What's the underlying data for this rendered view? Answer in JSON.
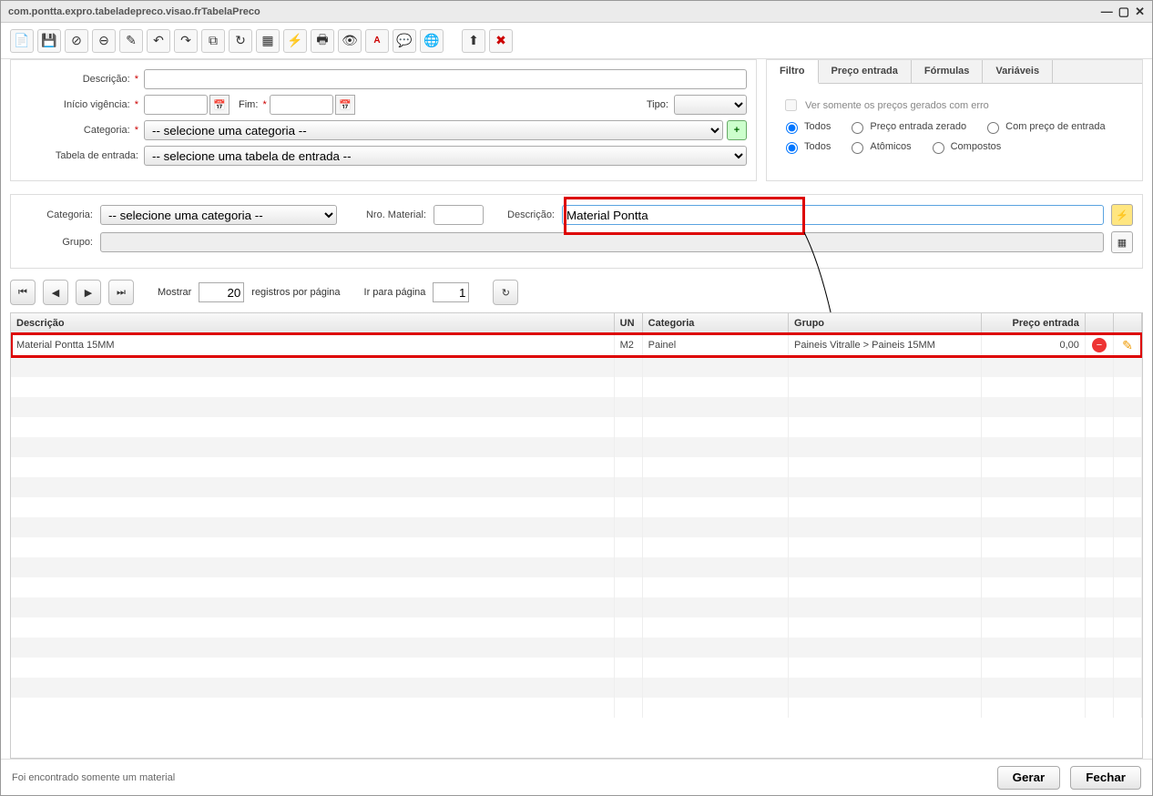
{
  "window": {
    "title": "com.pontta.expro.tabeladepreco.visao.frTabelaPreco"
  },
  "toolbar_icons": [
    "new",
    "save",
    "close",
    "undo",
    "edit",
    "redo-a",
    "redo-b",
    "copy",
    "refresh",
    "grid",
    "bolt",
    "print",
    "eye",
    "pdf",
    "chat",
    "globe",
    "separator",
    "up",
    "tools"
  ],
  "form": {
    "descricao_label": "Descrição:",
    "inicio_label": "Início vigência:",
    "fim_label": "Fim:",
    "tipo_label": "Tipo:",
    "categoria_label": "Categoria:",
    "categoria_placeholder": "-- selecione uma categoria --",
    "tabela_entrada_label": "Tabela de entrada:",
    "tabela_entrada_placeholder": "-- selecione uma tabela de entrada --"
  },
  "sidebar": {
    "tabs": [
      "Filtro",
      "Preço entrada",
      "Fórmulas",
      "Variáveis"
    ],
    "active_tab": 0,
    "ver_somente": "Ver somente os preços gerados com erro",
    "row1": {
      "todos": "Todos",
      "preco_zerado": "Preço entrada zerado",
      "com_preco": "Com preço de entrada"
    },
    "row2": {
      "todos": "Todos",
      "atomicos": "Atômicos",
      "compostos": "Compostos"
    }
  },
  "search": {
    "categoria_label": "Categoria:",
    "categoria_placeholder": "-- selecione uma categoria --",
    "nro_material_label": "Nro. Material:",
    "descricao_label": "Descrição:",
    "descricao_value": "Material Pontta",
    "grupo_label": "Grupo:"
  },
  "pager": {
    "mostrar_label": "Mostrar",
    "mostrar_value": "20",
    "mostrar_suffix": "registros por página",
    "ir_label": "Ir para página",
    "ir_value": "1"
  },
  "table": {
    "headers": {
      "descricao": "Descrição",
      "un": "UN",
      "categoria": "Categoria",
      "grupo": "Grupo",
      "preco_entrada": "Preço entrada"
    },
    "rows": [
      {
        "descricao": "Material Pontta 15MM",
        "un": "M2",
        "categoria": "Painel",
        "grupo": "Paineis Vitralle > Paineis 15MM",
        "preco_entrada": "0,00"
      }
    ]
  },
  "footer": {
    "status": "Foi encontrado somente um material",
    "gerar": "Gerar",
    "fechar": "Fechar"
  }
}
